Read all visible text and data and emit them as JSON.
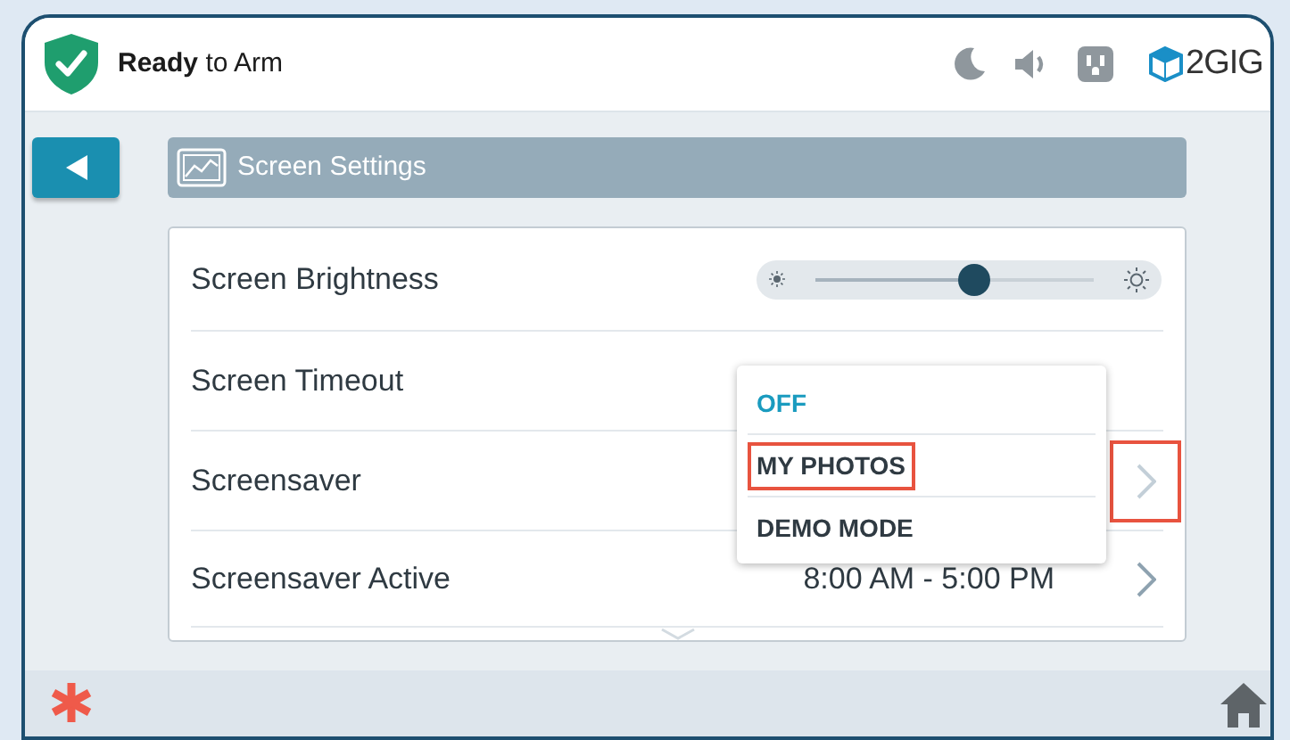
{
  "header": {
    "status": "**Ready** to Arm",
    "logo_text": "2GIG"
  },
  "title": "Screen Settings",
  "rows": [
    {
      "kind": "slider",
      "label": "Screen Brightness",
      "level": 0.57
    },
    {
      "kind": "plain",
      "label": "Screen Timeout"
    },
    {
      "kind": "chevron",
      "label": "Screensaver",
      "highlighted": true,
      "dimmed": true
    },
    {
      "kind": "chevron",
      "label": "Screensaver Active",
      "value": "8:00 AM - 5:00 PM",
      "highlighted": false,
      "dimmed": false
    }
  ],
  "dropdown": {
    "options": [
      {
        "label": "OFF",
        "selected": true,
        "highlighted": false
      },
      {
        "label": "MY PHOTOS",
        "selected": false,
        "highlighted": true
      },
      {
        "label": "DEMO MODE",
        "selected": false,
        "highlighted": false
      }
    ]
  }
}
